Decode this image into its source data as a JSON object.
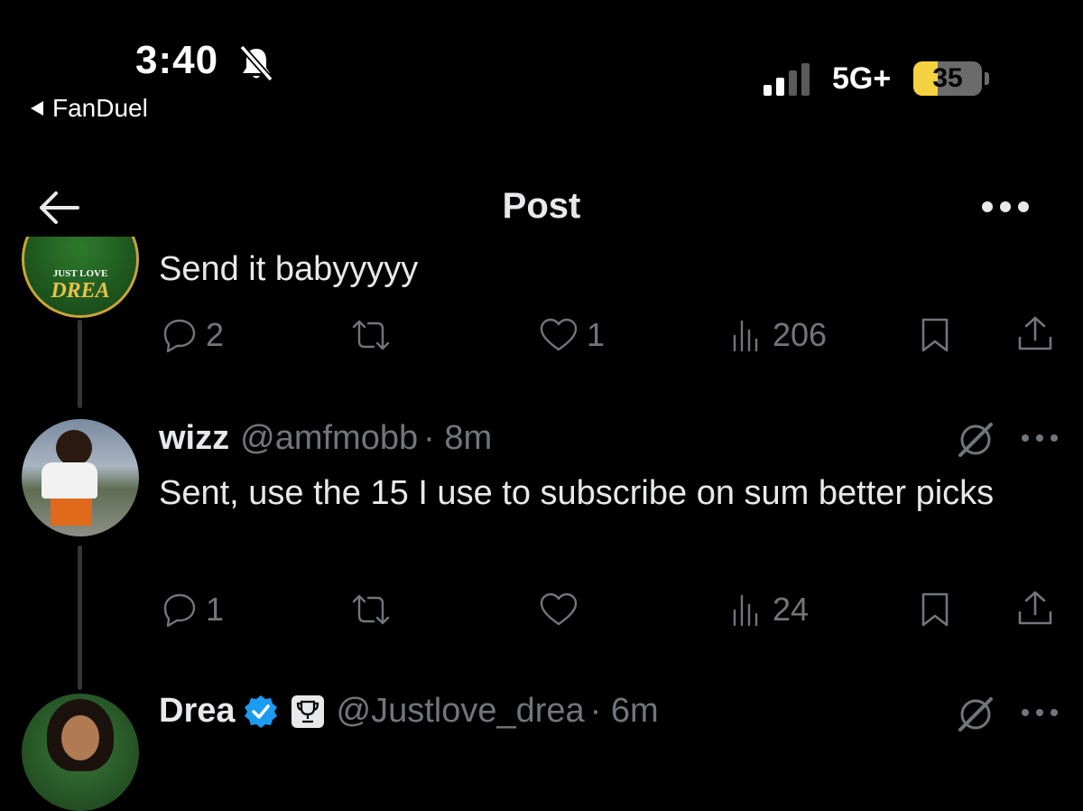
{
  "status_bar": {
    "time": "3:40",
    "back_app": "FanDuel",
    "network": "5G+",
    "battery": "35",
    "battery_level": 0.35
  },
  "header": {
    "title": "Post"
  },
  "posts": [
    {
      "avatar_text": [
        "JUST LOVE",
        "DREA"
      ],
      "text": "Send it babyyyyy",
      "replies": "2",
      "reposts": "",
      "likes": "1",
      "views": "206"
    },
    {
      "name": "wizz",
      "handle": "@amfmobb",
      "time": "· 8m",
      "text": "Sent, use the 15 I use to subscribe on sum better picks",
      "replies": "1",
      "reposts": "",
      "likes": "",
      "views": "24"
    },
    {
      "name": "Drea",
      "handle": "@Justlove_drea",
      "time": "· 6m",
      "verified": true
    }
  ],
  "colors": {
    "background": "#000000",
    "text": "#e7e9ea",
    "muted": "#71767b",
    "verified": "#1d9bf0",
    "battery": "#f5d23f"
  }
}
